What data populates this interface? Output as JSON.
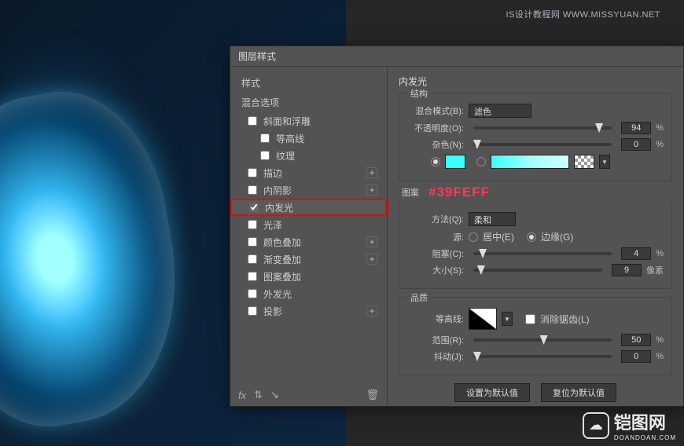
{
  "watermark_top": "IS设计教程网 WWW.MISSYUAN.NET",
  "dialog": {
    "title": "图层样式",
    "left": {
      "style_header": "样式",
      "blend_header": "混合选项",
      "items": [
        {
          "label": "斜面和浮雕",
          "checked": false,
          "plus": false
        },
        {
          "label": "等高线",
          "checked": false,
          "plus": false,
          "indent": true
        },
        {
          "label": "纹理",
          "checked": false,
          "plus": false,
          "indent": true
        },
        {
          "label": "描边",
          "checked": false,
          "plus": true
        },
        {
          "label": "内阴影",
          "checked": false,
          "plus": true
        },
        {
          "label": "内发光",
          "checked": true,
          "plus": false,
          "selected": true
        },
        {
          "label": "光泽",
          "checked": false,
          "plus": false
        },
        {
          "label": "颜色叠加",
          "checked": false,
          "plus": true
        },
        {
          "label": "渐变叠加",
          "checked": false,
          "plus": true
        },
        {
          "label": "图案叠加",
          "checked": false,
          "plus": false
        },
        {
          "label": "外发光",
          "checked": false,
          "plus": false
        },
        {
          "label": "投影",
          "checked": false,
          "plus": true
        }
      ],
      "fx_label": "fx"
    },
    "right": {
      "panel_title": "内发光",
      "structure": {
        "group": "结构",
        "blend_mode_label": "混合模式(B):",
        "blend_mode_value": "滤色",
        "opacity_label": "不透明度(O):",
        "opacity_value": "94",
        "opacity_unit": "%",
        "noise_label": "杂色(N):",
        "noise_value": "0",
        "noise_unit": "%",
        "hex_annotation": "#39FEFF",
        "color_hex": "#39FEFF"
      },
      "elements": {
        "group": "图案",
        "technique_label": "方法(Q):",
        "technique_value": "柔和",
        "source_label": "源:",
        "source_center": "居中(E)",
        "source_edge": "边缘(G)",
        "source_selected": "edge",
        "choke_label": "阻塞(C):",
        "choke_value": "4",
        "choke_unit": "%",
        "size_label": "大小(S):",
        "size_value": "9",
        "size_unit": "像素"
      },
      "quality": {
        "group": "品质",
        "contour_label": "等高线:",
        "anti_alias_label": "消除锯齿(L)",
        "range_label": "范围(R):",
        "range_value": "50",
        "range_unit": "%",
        "jitter_label": "抖动(J):",
        "jitter_value": "0",
        "jitter_unit": "%"
      },
      "buttons": {
        "make_default": "设置为默认值",
        "reset_default": "复位为默认值"
      }
    }
  },
  "corner_logo": {
    "text": "铠图网",
    "sub": "DOANDOAN.COM"
  }
}
